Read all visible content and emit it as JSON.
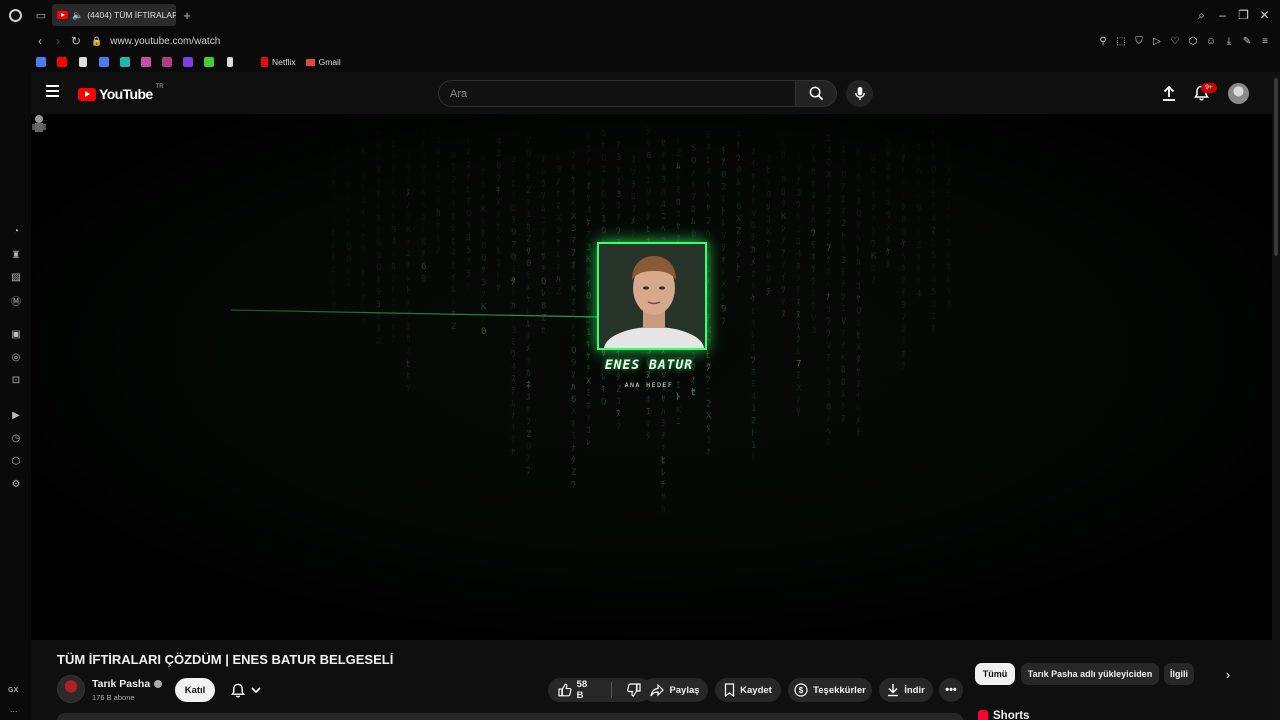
{
  "browser": {
    "tab_title": "(4404) TÜM İFTİRALAR",
    "url": "www.youtube.com/watch",
    "bookmarks": [
      {
        "label": "",
        "color": "#4a7cf0"
      },
      {
        "label": "",
        "color": "#ff0000"
      },
      {
        "label": "",
        "color": "#dddddd"
      },
      {
        "label": "",
        "color": "#4a7cf0"
      },
      {
        "label": "",
        "color": "#1fb6a8"
      },
      {
        "label": "",
        "color": "#c84fa0"
      },
      {
        "label": "",
        "color": "#b0407a"
      },
      {
        "label": "",
        "color": "#7b3fe4"
      },
      {
        "label": "",
        "color": "#44cc33"
      },
      {
        "label": "",
        "color": "#dddddd"
      }
    ],
    "bookmark_netflix": "Netflix",
    "bookmark_gmail": "Gmail",
    "gx_label": "GX",
    "gx_more": "..."
  },
  "youtube": {
    "country_code": "TR",
    "logo_text": "YouTube",
    "search_placeholder": "Ara",
    "notification_badge": "9+"
  },
  "video": {
    "overlay_name": "ENES BATUR",
    "overlay_sub": "ANA HEDEF",
    "title": "TÜM İFTİRALARI ÇÖZDÜM | ENES BATUR BELGESELİ",
    "channel": "Tarık Pasha",
    "subscribers": "176 B abone",
    "join_label": "Katıl",
    "likes": "58 B",
    "share": "Paylaş",
    "save": "Kaydet",
    "thanks": "Teşekkürler",
    "download": "İndir"
  },
  "chips": {
    "all": "Tümü",
    "from_uploader": "Tarık Pasha adlı yükleyiciden",
    "related": "İlgili"
  },
  "shorts_title": "Shorts",
  "colors": {
    "accent_red": "#ff0000",
    "matrix_green": "#3cff6c",
    "background": "#0f0f0f"
  }
}
